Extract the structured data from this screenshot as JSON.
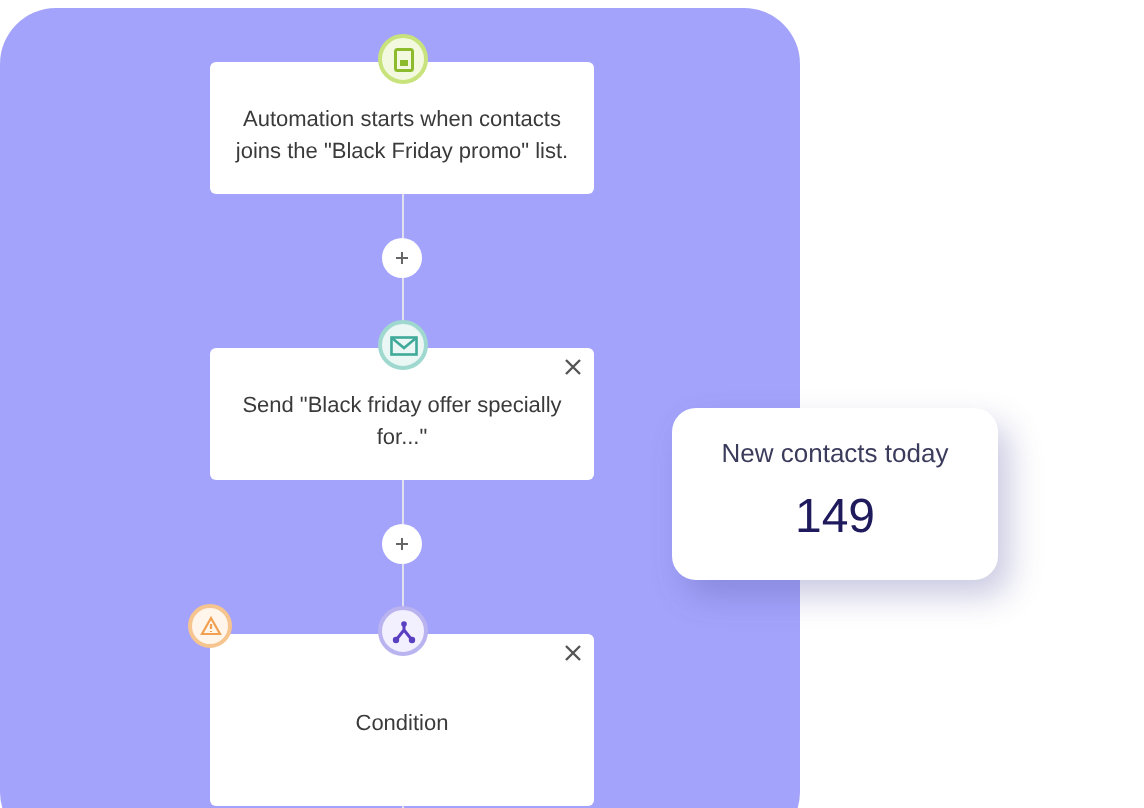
{
  "steps": [
    {
      "kind": "trigger",
      "text": "Automation starts when contacts joins the \"Black Friday promo\" list.",
      "closable": false,
      "warning": false
    },
    {
      "kind": "email",
      "text": "Send \"Black friday offer specially for...\"",
      "closable": true,
      "warning": false
    },
    {
      "kind": "condition",
      "text": "Condition",
      "closable": true,
      "warning": true
    }
  ],
  "stat_card": {
    "label": "New contacts today",
    "value": "149"
  }
}
